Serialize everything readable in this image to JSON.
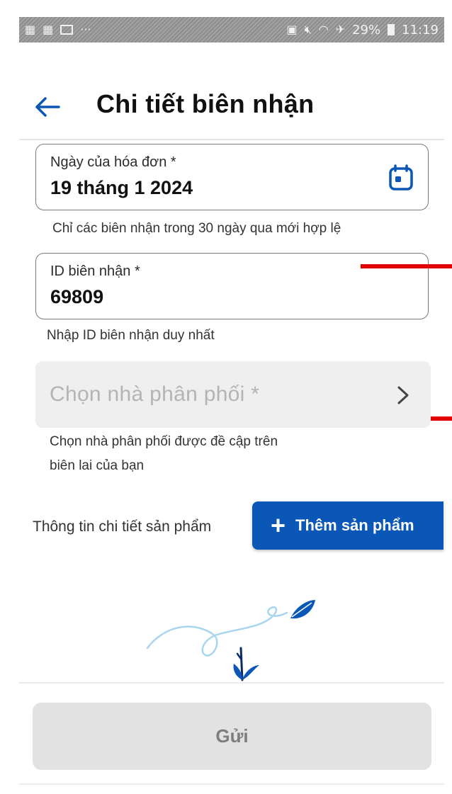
{
  "status_bar": {
    "battery": "29%",
    "time": "11:19",
    "dots": "···"
  },
  "header": {
    "title": "Chi tiết biên nhận"
  },
  "invoice_date": {
    "label": "Ngày của hóa đơn *",
    "value": "19 tháng 1 2024",
    "helper": "Chỉ các biên nhận trong 30 ngày qua mới hợp lệ"
  },
  "receipt_id": {
    "label": "ID biên nhận *",
    "value": "69809",
    "helper": "Nhập ID biên nhận duy nhất"
  },
  "distributor": {
    "placeholder": "Chọn nhà phân phối *",
    "helper_line1": "Chọn nhà phân phối được đề cập trên",
    "helper_line2": "biên lai của bạn"
  },
  "products": {
    "section_label": "Thông tin chi tiết sản phẩm",
    "add_button": "Thêm sản phẩm"
  },
  "submit_label": "Gửi",
  "colors": {
    "primary": "#0a57b7",
    "annotation_red": "#e30000"
  }
}
